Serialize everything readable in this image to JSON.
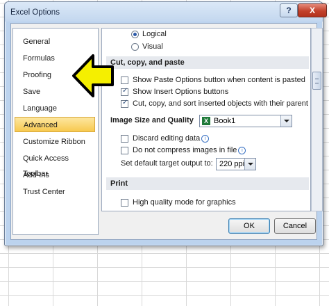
{
  "window": {
    "title": "Excel Options",
    "help_label": "?",
    "close_label": "X"
  },
  "nav": {
    "items": [
      {
        "label": "General"
      },
      {
        "label": "Formulas"
      },
      {
        "label": "Proofing"
      },
      {
        "label": "Save"
      },
      {
        "label": "Language"
      },
      {
        "label": "Advanced",
        "active": true
      },
      {
        "label": "Customize Ribbon"
      },
      {
        "label": "Quick Access Toolbar"
      },
      {
        "label": "Add-Ins"
      },
      {
        "label": "Trust Center"
      }
    ]
  },
  "content": {
    "radios": [
      {
        "label": "Logical",
        "checked": true
      },
      {
        "label": "Visual",
        "checked": false
      }
    ],
    "cut_copy_paste": {
      "heading": "Cut, copy, and paste",
      "options": [
        {
          "label": "Show Paste Options button when content is pasted",
          "checked": false
        },
        {
          "label": "Show Insert Options buttons",
          "checked": true
        },
        {
          "label": "Cut, copy, and sort inserted objects with their parent cells",
          "checked": true
        }
      ]
    },
    "image_size": {
      "heading": "Image Size and Quality",
      "workbook": "Book1",
      "options": [
        {
          "label": "Discard editing data",
          "checked": false
        },
        {
          "label": "Do not compress images in file",
          "checked": false
        }
      ],
      "target_output_label": "Set default target output to:",
      "target_output_value": "220 ppi"
    },
    "print": {
      "heading": "Print",
      "options": [
        {
          "label": "High quality mode for graphics",
          "checked": false
        }
      ]
    }
  },
  "buttons": {
    "ok": "OK",
    "cancel": "Cancel"
  },
  "colors": {
    "arrow_fill": "#f5ef00",
    "arrow_stroke": "#000000",
    "active_nav": "#f7c94f"
  },
  "icons": {
    "info": "info-icon",
    "excel": "excel-workbook-icon"
  }
}
